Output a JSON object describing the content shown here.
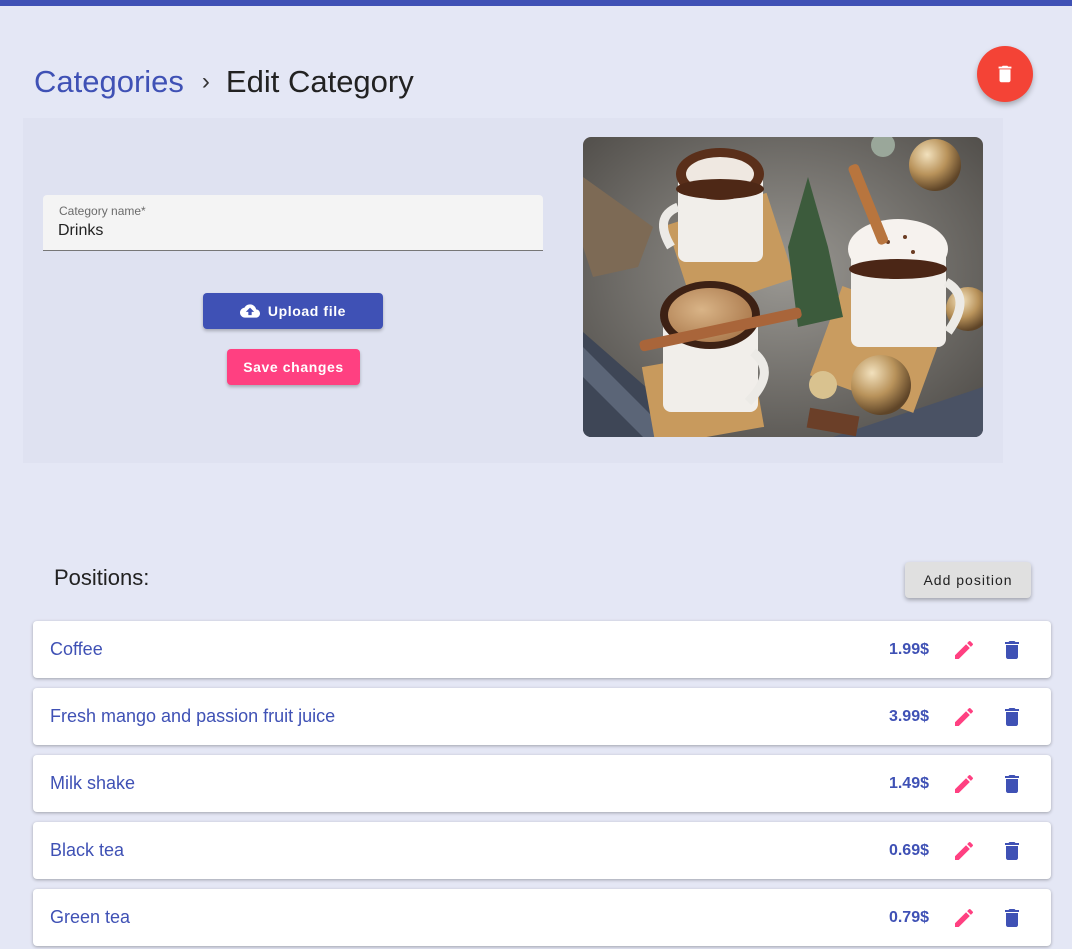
{
  "breadcrumb": {
    "parent": "Categories",
    "separator": "›",
    "current": "Edit Category"
  },
  "form": {
    "name_label": "Category name*",
    "name_value": "Drinks",
    "upload_label": "Upload file",
    "save_label": "Save changes"
  },
  "positions": {
    "title": "Positions:",
    "add_label": "Add position",
    "items": [
      {
        "name": "Coffee",
        "price": "1.99$"
      },
      {
        "name": "Fresh mango and passion fruit juice",
        "price": "3.99$"
      },
      {
        "name": "Milk shake",
        "price": "1.49$"
      },
      {
        "name": "Black tea",
        "price": "0.69$"
      },
      {
        "name": "Green tea",
        "price": "0.79$"
      }
    ]
  },
  "icons": {
    "delete_category": "trash-icon",
    "upload": "cloud-upload-icon",
    "edit": "pencil-icon",
    "delete": "trash-icon"
  },
  "colors": {
    "primary": "#3f51b5",
    "accent": "#ff4081",
    "warn": "#f44336",
    "background": "#e4e7f5"
  }
}
